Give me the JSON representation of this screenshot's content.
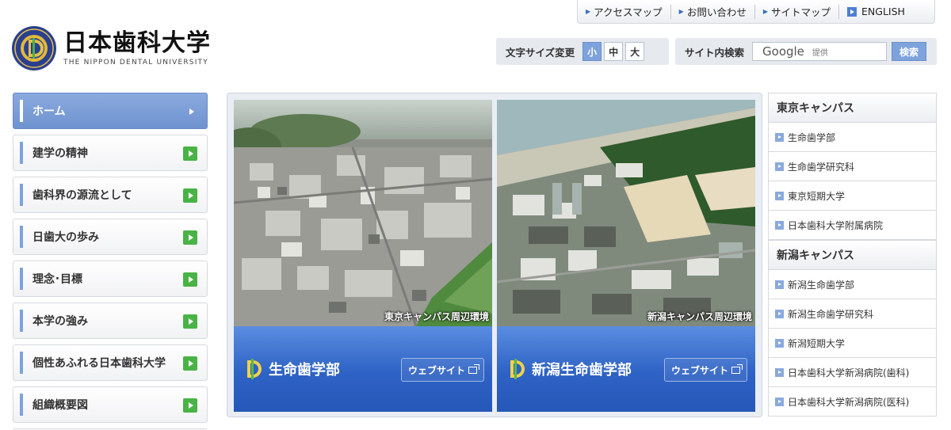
{
  "utility_nav": [
    {
      "label": "アクセスマップ",
      "icon": "triangle-right-icon"
    },
    {
      "label": "お問い合わせ",
      "icon": "triangle-right-icon"
    },
    {
      "label": "サイトマップ",
      "icon": "triangle-right-icon"
    },
    {
      "label": "ENGLISH",
      "icon": "square-arrow-icon"
    }
  ],
  "logo": {
    "jp": "日本歯科大学",
    "en": "THE NIPPON DENTAL UNIVERSITY"
  },
  "font_size": {
    "label": "文字サイズ変更",
    "options": [
      "小",
      "中",
      "大"
    ],
    "selected": "小"
  },
  "search": {
    "label": "サイト内検索",
    "provider": "Google",
    "provider_suffix": "提供",
    "button": "検索"
  },
  "nav": [
    {
      "label": "ホーム",
      "active": true
    },
    {
      "label": "建学の精神"
    },
    {
      "label": "歯科界の源流として"
    },
    {
      "label": "日歯大の歩み"
    },
    {
      "label": "理念･目標"
    },
    {
      "label": "本学の強み"
    },
    {
      "label": "個性あふれる日本歯科大学"
    },
    {
      "label": "組織概要図"
    }
  ],
  "cards": [
    {
      "caption": "東京キャンパス周辺環境",
      "name": "生命歯学部",
      "web": "ウェブサイト"
    },
    {
      "caption": "新潟キャンパス周辺環境",
      "name": "新潟生命歯学部",
      "web": "ウェブサイト"
    }
  ],
  "tokyo": {
    "heading": "東京キャンパス",
    "items": [
      "生命歯学部",
      "生命歯学研究科",
      "東京短期大学",
      "日本歯科大学附属病院"
    ]
  },
  "niigata": {
    "heading": "新潟キャンパス",
    "items": [
      "新潟生命歯学部",
      "新潟生命歯学研究科",
      "新潟短期大学",
      "日本歯科大学新潟病院(歯科)",
      "日本歯科大学新潟病院(医科)"
    ]
  },
  "colors": {
    "accent": "#7ea2dc",
    "band": "#2e62c4",
    "arrow": "#49b345"
  }
}
